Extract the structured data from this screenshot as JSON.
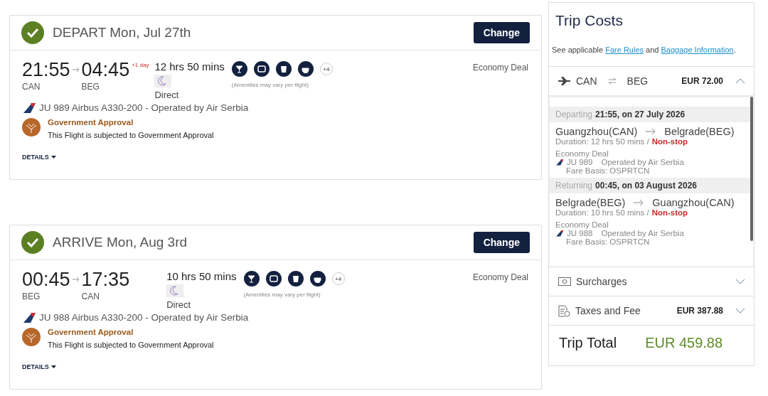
{
  "flights": [
    {
      "direction": "DEPART",
      "date": "Mon, Jul 27th",
      "confirmed": true,
      "change_button": "Change",
      "depart_time": "21:55",
      "depart_code": "CAN",
      "arrive_time": "04:45",
      "arrive_code": "BEG",
      "day_change": "+1 day",
      "duration": "12 hrs 50 mins",
      "stops": "Direct",
      "amenities_more": "+4",
      "amenities_note": "(Amenities may vary per flight)",
      "cabin": "Economy Deal",
      "flight_info": "JU 989 Airbus A330-200 - Operated by Air Serbia",
      "notice_title": "Government Approval",
      "notice_text": "This Flight is subjected to Government Approval",
      "details": "DETAILS"
    },
    {
      "direction": "ARRIVE",
      "date": "Mon, Aug 3rd",
      "confirmed": true,
      "change_button": "Change",
      "depart_time": "00:45",
      "depart_code": "BEG",
      "arrive_time": "17:35",
      "arrive_code": "CAN",
      "duration": "10 hrs 50 mins",
      "stops": "Direct",
      "amenities_more": "+4",
      "amenities_note": "(Amenities may vary per flight)",
      "cabin": "Economy Deal",
      "flight_info": "JU 988 Airbus A330-200 - Operated by Air Serbia",
      "notice_title": "Government Approval",
      "notice_text": "This Flight is subjected to Government Approval",
      "details": "DETAILS"
    }
  ],
  "trip_costs": {
    "title": "Trip Costs",
    "intro_before": "See applicable",
    "fare_rules_link": "Fare Rules",
    "intro_middle": "and",
    "baggage_link": "Baggage Information",
    "intro_end": ".",
    "route": {
      "from": "CAN",
      "to": "BEG",
      "price": "EUR 72.00",
      "expanded": true
    },
    "segments": [
      {
        "label": "Departing",
        "when": "21:55, on 27 July 2026",
        "from": "Guangzhou(CAN)",
        "to": "Belgrade(BEG)",
        "duration": "Duration: 12 hrs 50 mins /",
        "stops": "Non-stop",
        "cabin": "Economy Deal",
        "flight": "JU 989",
        "operator": "Operated by Air Serbia",
        "fare_basis": "Fare Basis: OSPRTCN"
      },
      {
        "label": "Returning",
        "when": "00:45, on 03 August 2026",
        "from": "Belgrade(BEG)",
        "to": "Guangzhou(CAN)",
        "duration": "Duration: 10 hrs 50 mins /",
        "stops": "Non-stop",
        "cabin": "Economy Deal",
        "flight": "JU 988",
        "operator": "Operated by Air Serbia",
        "fare_basis": "Fare Basis: OSPRTCN"
      }
    ],
    "rows": [
      {
        "kind": "surcharges",
        "label": "Surcharges",
        "expanded": false
      },
      {
        "kind": "taxes",
        "label": "Taxes and Fee",
        "amount": "EUR 387.88",
        "expanded": false
      }
    ],
    "total_label": "Trip Total",
    "total_amount": "EUR 459.88"
  }
}
